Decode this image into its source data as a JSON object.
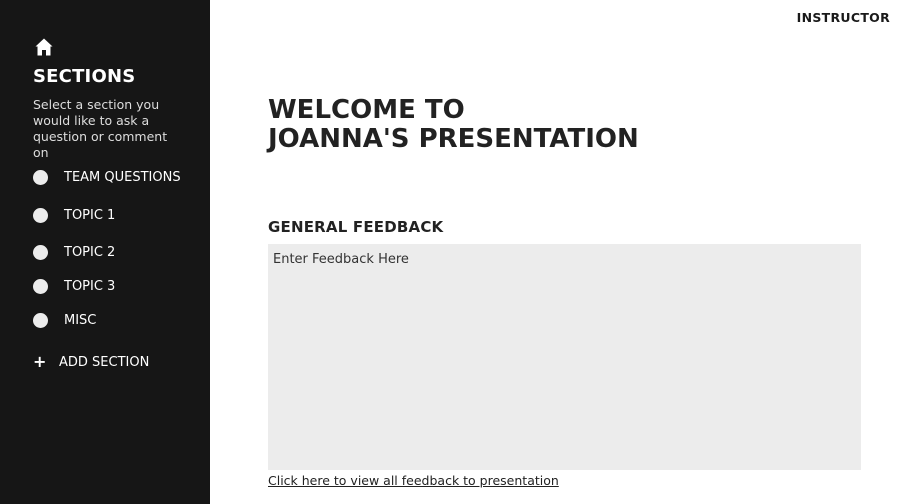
{
  "sidebar": {
    "home_icon": "home-icon",
    "title": "SECTIONS",
    "description": "Select a section you would like to ask a question or comment on",
    "items": [
      {
        "label": "TEAM QUESTIONS"
      },
      {
        "label": "TOPIC 1"
      },
      {
        "label": "TOPIC 2"
      },
      {
        "label": "TOPIC 3"
      },
      {
        "label": "MISC"
      }
    ],
    "add_section_icon": "plus-icon",
    "add_section_label": "ADD SECTION"
  },
  "header": {
    "role_label": "INSTRUCTOR"
  },
  "main": {
    "welcome_line1": "WELCOME TO",
    "welcome_line2": "JOANNA'S PRESENTATION",
    "feedback_heading": "GENERAL FEEDBACK",
    "feedback_placeholder": "Enter Feedback Here",
    "feedback_value": "",
    "view_all_link": "Click here to view all feedback to presentation"
  },
  "colors": {
    "sidebar_bg": "#161616",
    "feedback_box_bg": "#ececec",
    "text": "#222222"
  }
}
